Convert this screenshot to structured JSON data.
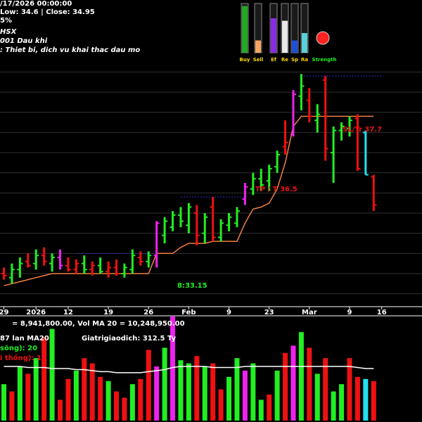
{
  "header": {
    "line1": "/17/2026 00:00:00",
    "line2": "Low: 34.6  | Close: 34.95",
    "line3": "5%",
    "line4": "HSX",
    "line5": "001 Dau khi",
    "line6": ": Thiet bi, dich vu khai thac dau mo"
  },
  "indicator_panel": {
    "labels": [
      "Buy",
      "Sell",
      "Ef",
      "Re",
      "Sp",
      "Ra"
    ],
    "strength_label": "Strength",
    "colors": {
      "buy": "#22aa22",
      "sell": "#f4a460",
      "ef": "#8a2be2",
      "re": "#e8e8e8",
      "sp": "#1e4fd8",
      "ra": "#5ad0d8",
      "strength": "#ff2222"
    },
    "levels": {
      "buy": 0.95,
      "sell": 0.25,
      "ef": 0.7,
      "re": 0.65,
      "sp": 0.25,
      "ra": 0.4
    }
  },
  "annotations": {
    "stop_label": "8:33.15",
    "tp_label": "TP / T   36.5",
    "sl_label": "SL/Tr    37.7"
  },
  "volume_panel": {
    "top_text": "= 8,941,800.00, Vol MA 20 = 10,248,950.00",
    "ratio_text": "87 lan MA20",
    "value_text": "Giatrigiaodich: 312.5   Ty",
    "up_text": "sõng): 20",
    "down_text": "i thống): 10"
  },
  "colors": {
    "up": "#22ee22",
    "down": "#ee1111",
    "magenta": "#ee22ee",
    "cyan": "#22e0f0",
    "trail": "#f08040",
    "ma": "#ffffff",
    "grid": "#303030",
    "resistance": "#3030d0"
  },
  "chart_data": {
    "type": "candlestick",
    "x_tick_labels": [
      "29",
      "2026",
      "12",
      "19",
      "26",
      "Feb",
      "9",
      "23",
      "Mar",
      "9",
      "16"
    ],
    "y_range": [
      28.5,
      40.5
    ],
    "candles": [
      {
        "o": 30.0,
        "h": 30.3,
        "l": 29.7,
        "c": 29.9,
        "col": "down"
      },
      {
        "o": 29.8,
        "h": 30.5,
        "l": 29.5,
        "c": 30.2,
        "col": "up"
      },
      {
        "o": 30.2,
        "h": 30.8,
        "l": 29.8,
        "c": 30.5,
        "col": "up"
      },
      {
        "o": 30.6,
        "h": 31.0,
        "l": 30.3,
        "c": 30.4,
        "col": "down"
      },
      {
        "o": 30.5,
        "h": 31.2,
        "l": 30.2,
        "c": 30.9,
        "col": "up"
      },
      {
        "o": 30.9,
        "h": 31.3,
        "l": 30.4,
        "c": 30.6,
        "col": "down"
      },
      {
        "o": 30.5,
        "h": 31.0,
        "l": 30.1,
        "c": 30.8,
        "col": "up"
      },
      {
        "o": 30.8,
        "h": 31.2,
        "l": 30.2,
        "c": 30.4,
        "col": "magenta"
      },
      {
        "o": 30.4,
        "h": 30.8,
        "l": 30.1,
        "c": 30.2,
        "col": "down"
      },
      {
        "o": 30.2,
        "h": 30.7,
        "l": 30.0,
        "c": 30.5,
        "col": "down"
      },
      {
        "o": 30.5,
        "h": 30.9,
        "l": 30.0,
        "c": 30.2,
        "col": "up"
      },
      {
        "o": 30.2,
        "h": 30.6,
        "l": 29.9,
        "c": 30.4,
        "col": "down"
      },
      {
        "o": 30.4,
        "h": 30.8,
        "l": 30.0,
        "c": 30.1,
        "col": "up"
      },
      {
        "o": 30.1,
        "h": 30.6,
        "l": 29.8,
        "c": 30.3,
        "col": "down"
      },
      {
        "o": 30.3,
        "h": 30.7,
        "l": 29.9,
        "c": 30.0,
        "col": "down"
      },
      {
        "o": 30.0,
        "h": 30.5,
        "l": 29.8,
        "c": 30.3,
        "col": "up"
      },
      {
        "o": 30.2,
        "h": 31.2,
        "l": 30.0,
        "c": 30.9,
        "col": "up"
      },
      {
        "o": 30.8,
        "h": 31.1,
        "l": 30.4,
        "c": 30.6,
        "col": "down"
      },
      {
        "o": 30.6,
        "h": 31.1,
        "l": 30.3,
        "c": 30.9,
        "col": "up"
      },
      {
        "o": 30.9,
        "h": 32.6,
        "l": 30.3,
        "c": 32.5,
        "col": "magenta"
      },
      {
        "o": 31.9,
        "h": 32.8,
        "l": 31.5,
        "c": 32.6,
        "col": "up"
      },
      {
        "o": 32.3,
        "h": 33.1,
        "l": 32.1,
        "c": 32.9,
        "col": "up"
      },
      {
        "o": 32.9,
        "h": 33.3,
        "l": 32.3,
        "c": 32.6,
        "col": "up"
      },
      {
        "o": 32.4,
        "h": 33.5,
        "l": 32.0,
        "c": 33.3,
        "col": "up"
      },
      {
        "o": 33.0,
        "h": 33.4,
        "l": 31.4,
        "c": 31.9,
        "col": "down"
      },
      {
        "o": 32.0,
        "h": 33.0,
        "l": 31.5,
        "c": 32.8,
        "col": "up"
      },
      {
        "o": 33.3,
        "h": 33.8,
        "l": 31.6,
        "c": 31.8,
        "col": "down"
      },
      {
        "o": 31.8,
        "h": 32.7,
        "l": 31.6,
        "c": 32.5,
        "col": "up"
      },
      {
        "o": 32.4,
        "h": 33.0,
        "l": 32.1,
        "c": 32.8,
        "col": "up"
      },
      {
        "o": 32.5,
        "h": 33.3,
        "l": 32.3,
        "c": 33.1,
        "col": "up"
      },
      {
        "o": 33.7,
        "h": 34.5,
        "l": 33.4,
        "c": 34.3,
        "col": "magenta"
      },
      {
        "o": 34.2,
        "h": 35.0,
        "l": 33.9,
        "c": 34.7,
        "col": "up"
      },
      {
        "o": 34.7,
        "h": 35.2,
        "l": 34.1,
        "c": 34.4,
        "col": "up"
      },
      {
        "o": 34.6,
        "h": 35.4,
        "l": 34.1,
        "c": 35.2,
        "col": "up"
      },
      {
        "o": 35.3,
        "h": 36.1,
        "l": 35.0,
        "c": 35.9,
        "col": "up"
      },
      {
        "o": 36.3,
        "h": 37.6,
        "l": 35.9,
        "c": 36.5,
        "col": "down"
      },
      {
        "o": 36.9,
        "h": 39.1,
        "l": 36.8,
        "c": 38.9,
        "col": "magenta"
      },
      {
        "o": 38.8,
        "h": 39.9,
        "l": 38.1,
        "c": 39.3,
        "col": "up"
      },
      {
        "o": 38.6,
        "h": 39.2,
        "l": 37.5,
        "c": 37.8,
        "col": "down"
      },
      {
        "o": 37.6,
        "h": 38.4,
        "l": 37.0,
        "c": 37.9,
        "col": "up"
      },
      {
        "o": 39.6,
        "h": 39.8,
        "l": 35.6,
        "c": 36.2,
        "col": "down"
      },
      {
        "o": 36.0,
        "h": 37.3,
        "l": 34.5,
        "c": 37.1,
        "col": "up"
      },
      {
        "o": 37.1,
        "h": 37.5,
        "l": 36.6,
        "c": 37.3,
        "col": "up"
      },
      {
        "o": 37.2,
        "h": 37.8,
        "l": 36.8,
        "c": 37.6,
        "col": "up"
      },
      {
        "o": 37.7,
        "h": 37.9,
        "l": 35.1,
        "c": 35.2,
        "col": "down"
      },
      {
        "o": 37.0,
        "h": 37.1,
        "l": 34.9,
        "c": 34.9,
        "col": "cyan"
      },
      {
        "o": 34.8,
        "h": 34.9,
        "l": 33.1,
        "c": 33.4,
        "col": "down"
      }
    ],
    "trailing_stop": [
      29.4,
      29.5,
      29.6,
      29.7,
      29.8,
      29.9,
      30.0,
      30.0,
      30.0,
      30.0,
      30.0,
      30.0,
      30.0,
      30.0,
      30.0,
      30.0,
      30.0,
      30.0,
      30.0,
      31.0,
      31.0,
      31.0,
      31.3,
      31.5,
      31.5,
      31.5,
      31.6,
      31.6,
      31.6,
      31.6,
      32.5,
      33.2,
      33.3,
      33.5,
      34.2,
      35.5,
      37.3,
      37.8,
      37.8,
      37.8,
      37.8,
      37.8,
      37.8,
      37.8,
      37.8,
      37.8,
      37.8
    ],
    "volumes": [
      {
        "v": 0.35,
        "col": "up"
      },
      {
        "v": 0.28,
        "col": "down"
      },
      {
        "v": 0.52,
        "col": "up"
      },
      {
        "v": 0.45,
        "col": "down"
      },
      {
        "v": 0.6,
        "col": "up"
      },
      {
        "v": 0.8,
        "col": "down"
      },
      {
        "v": 0.88,
        "col": "up"
      },
      {
        "v": 0.2,
        "col": "down"
      },
      {
        "v": 0.4,
        "col": "down"
      },
      {
        "v": 0.48,
        "col": "up"
      },
      {
        "v": 0.6,
        "col": "down"
      },
      {
        "v": 0.55,
        "col": "down"
      },
      {
        "v": 0.42,
        "col": "down"
      },
      {
        "v": 0.38,
        "col": "up"
      },
      {
        "v": 0.28,
        "col": "down"
      },
      {
        "v": 0.22,
        "col": "down"
      },
      {
        "v": 0.35,
        "col": "up"
      },
      {
        "v": 0.4,
        "col": "down"
      },
      {
        "v": 0.68,
        "col": "down"
      },
      {
        "v": 0.52,
        "col": "magenta"
      },
      {
        "v": 0.7,
        "col": "up"
      },
      {
        "v": 1.0,
        "col": "magenta"
      },
      {
        "v": 0.58,
        "col": "up"
      },
      {
        "v": 0.55,
        "col": "up"
      },
      {
        "v": 0.62,
        "col": "down"
      },
      {
        "v": 0.52,
        "col": "up"
      },
      {
        "v": 0.55,
        "col": "down"
      },
      {
        "v": 0.3,
        "col": "down"
      },
      {
        "v": 0.42,
        "col": "up"
      },
      {
        "v": 0.6,
        "col": "up"
      },
      {
        "v": 0.48,
        "col": "magenta"
      },
      {
        "v": 0.55,
        "col": "up"
      },
      {
        "v": 0.2,
        "col": "up"
      },
      {
        "v": 0.25,
        "col": "down"
      },
      {
        "v": 0.48,
        "col": "up"
      },
      {
        "v": 0.65,
        "col": "down"
      },
      {
        "v": 0.72,
        "col": "magenta"
      },
      {
        "v": 0.85,
        "col": "up"
      },
      {
        "v": 0.7,
        "col": "down"
      },
      {
        "v": 0.45,
        "col": "up"
      },
      {
        "v": 0.6,
        "col": "down"
      },
      {
        "v": 0.28,
        "col": "up"
      },
      {
        "v": 0.35,
        "col": "up"
      },
      {
        "v": 0.6,
        "col": "down"
      },
      {
        "v": 0.42,
        "col": "down"
      },
      {
        "v": 0.4,
        "col": "cyan"
      },
      {
        "v": 0.38,
        "col": "down"
      }
    ],
    "volume_ma": [
      0.52,
      0.52,
      0.52,
      0.51,
      0.51,
      0.51,
      0.5,
      0.5,
      0.5,
      0.49,
      0.49,
      0.48,
      0.47,
      0.47,
      0.46,
      0.46,
      0.46,
      0.46,
      0.47,
      0.48,
      0.49,
      0.51,
      0.52,
      0.52,
      0.52,
      0.52,
      0.51,
      0.51,
      0.51,
      0.51,
      0.52,
      0.52,
      0.52,
      0.52,
      0.52,
      0.52,
      0.52,
      0.52,
      0.52,
      0.52,
      0.52,
      0.52,
      0.52,
      0.52,
      0.51,
      0.5,
      0.5
    ]
  }
}
